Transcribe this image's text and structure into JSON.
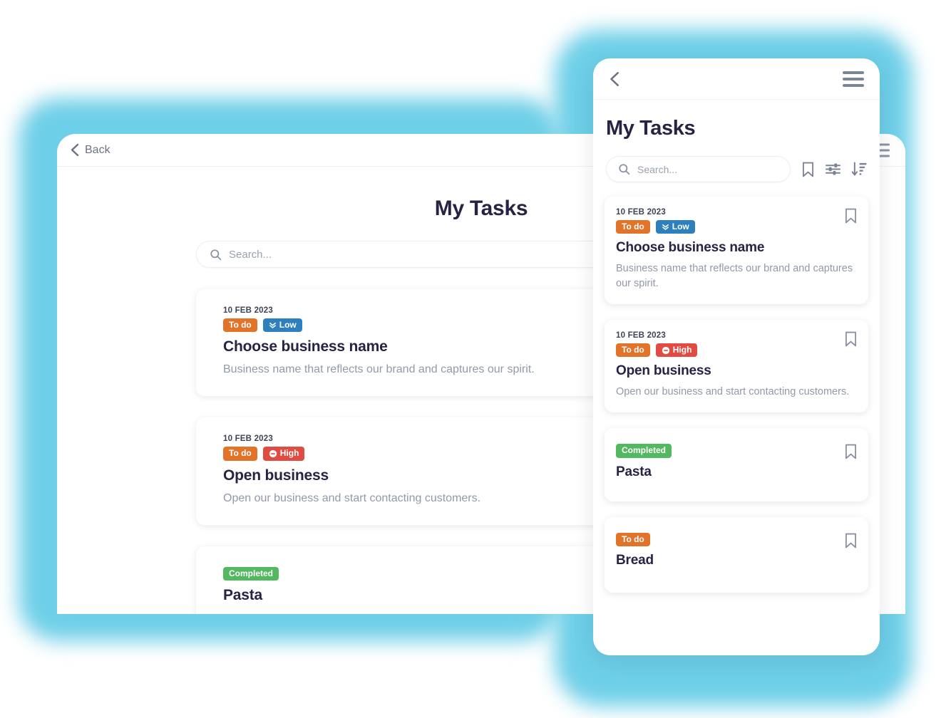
{
  "back_panel": {
    "topbar": {
      "back_label": "Back",
      "back_icon": "chevron-left-icon",
      "menu_icon": "hamburger-menu-icon"
    },
    "title": "My Tasks",
    "search": {
      "placeholder": "Search...",
      "value": "",
      "icon": "search-icon"
    },
    "cards": [
      {
        "date": "10 FEB 2023",
        "badges": [
          {
            "label": "To do",
            "kind": "todo",
            "icon": null
          },
          {
            "label": "Low",
            "kind": "low",
            "icon": "chevron-double-down-icon"
          }
        ],
        "title": "Choose business name",
        "description": "Business name that reflects our brand and captures our spirit.",
        "bookmark_icon": "bookmark-icon"
      },
      {
        "date": "10 FEB 2023",
        "badges": [
          {
            "label": "To do",
            "kind": "todo",
            "icon": null
          },
          {
            "label": "High",
            "kind": "high",
            "icon": "minus-circle-icon"
          }
        ],
        "title": "Open business",
        "description": "Open our business and start contacting customers.",
        "bookmark_icon": "bookmark-icon"
      },
      {
        "date": "",
        "badges": [
          {
            "label": "Completed",
            "kind": "completed",
            "icon": null
          }
        ],
        "title": "Pasta",
        "description": "",
        "bookmark_icon": "bookmark-icon"
      }
    ]
  },
  "front_panel": {
    "topbar": {
      "back_icon": "chevron-left-icon",
      "menu_icon": "hamburger-menu-icon"
    },
    "title": "My Tasks",
    "search": {
      "placeholder": "Search...",
      "value": "",
      "icon": "search-icon"
    },
    "tools": [
      {
        "name": "bookmark-filter-icon"
      },
      {
        "name": "filter-sliders-icon"
      },
      {
        "name": "sort-descending-icon"
      }
    ],
    "cards": [
      {
        "date": "10 FEB 2023",
        "badges": [
          {
            "label": "To do",
            "kind": "todo",
            "icon": null
          },
          {
            "label": "Low",
            "kind": "low",
            "icon": "chevron-double-down-icon"
          }
        ],
        "title": "Choose business name",
        "description": "Business name that reflects our brand and captures our spirit.",
        "bookmark_icon": "bookmark-icon"
      },
      {
        "date": "10 FEB 2023",
        "badges": [
          {
            "label": "To do",
            "kind": "todo",
            "icon": null
          },
          {
            "label": "High",
            "kind": "high",
            "icon": "minus-circle-icon"
          }
        ],
        "title": "Open business",
        "description": "Open our business and start contacting customers.",
        "bookmark_icon": "bookmark-icon"
      },
      {
        "date": "",
        "badges": [
          {
            "label": "Completed",
            "kind": "completed",
            "icon": null
          }
        ],
        "title": "Pasta",
        "description": "",
        "bookmark_icon": "bookmark-icon"
      },
      {
        "date": "",
        "badges": [
          {
            "label": "To do",
            "kind": "todo",
            "icon": null
          }
        ],
        "title": "Bread",
        "description": "",
        "bookmark_icon": "bookmark-icon"
      }
    ]
  },
  "colors": {
    "glow": "#6ecfe8",
    "title": "#262344",
    "muted": "#9299a8",
    "todo": "#e2742a",
    "low": "#2e7fbd",
    "high": "#e04b42",
    "completed": "#53b961"
  }
}
